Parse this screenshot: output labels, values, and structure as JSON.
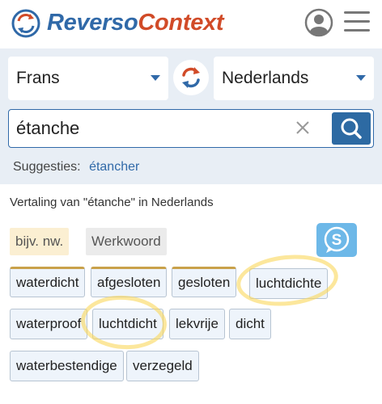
{
  "header": {
    "logo_part1": "Reverso",
    "logo_part2": "Context"
  },
  "search": {
    "source_language": "Frans",
    "target_language": "Nederlands",
    "query": "étanche",
    "suggestions_label": "Suggesties:",
    "suggestion": "étancher"
  },
  "results": {
    "title": "Vertaling van \"étanche\" in Nederlands",
    "pos_tags": [
      "bijv. nw.",
      "Werkwoord"
    ],
    "translations": [
      "waterdicht",
      "afgesloten",
      "gesloten",
      "luchtdichte",
      "waterproof",
      "luchtdicht",
      "lekvrije",
      "dicht",
      "waterbestendige",
      "verzegeld"
    ]
  },
  "colors": {
    "brand_blue": "#3069a8",
    "brand_red": "#d14b28",
    "highlight": "#fad75a"
  },
  "icons": [
    "reverso-logo-icon",
    "user-icon",
    "menu-icon",
    "caret-down-icon",
    "swap-icon",
    "clear-icon",
    "search-icon",
    "speech-s-icon"
  ]
}
